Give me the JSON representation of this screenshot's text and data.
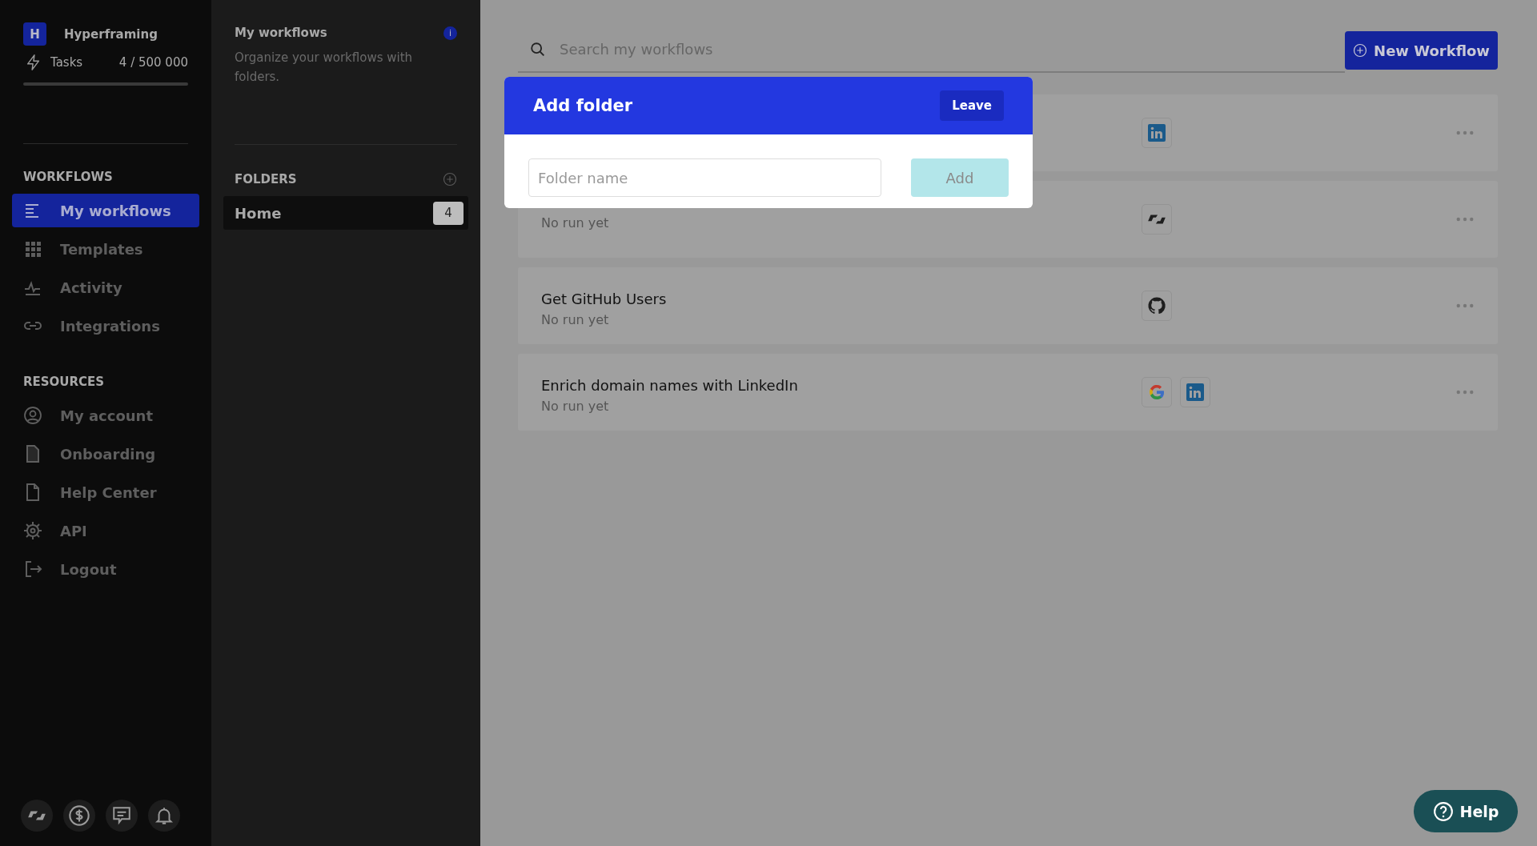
{
  "workspace": {
    "initial": "H",
    "name": "Hyperframing"
  },
  "tasks": {
    "label": "Tasks",
    "count": "4 / 500 000",
    "level": 0
  },
  "sidebar": {
    "sections": [
      {
        "title": "WORKFLOWS",
        "items": [
          {
            "label": "My workflows",
            "kind": "list",
            "selected": true
          },
          {
            "label": "Templates",
            "kind": "grid",
            "selected": false
          },
          {
            "label": "Activity",
            "kind": "activity",
            "selected": false
          },
          {
            "label": "Integrations",
            "kind": "link",
            "selected": false
          }
        ]
      },
      {
        "title": "RESOURCES",
        "items": [
          {
            "label": "My account",
            "kind": "account",
            "selected": false
          },
          {
            "label": "Onboarding",
            "kind": "doc-filled",
            "selected": false
          },
          {
            "label": "Help Center",
            "kind": "doc",
            "selected": false
          },
          {
            "label": "API",
            "kind": "gear",
            "selected": false
          },
          {
            "label": "Logout",
            "kind": "logout",
            "selected": false
          }
        ]
      }
    ],
    "footer_icons": [
      {
        "kind": "logo"
      },
      {
        "kind": "dollar"
      },
      {
        "kind": "chat"
      },
      {
        "kind": "bell"
      }
    ]
  },
  "folders_panel": {
    "title": "My workflows",
    "info": "i",
    "description": "Organize your workflows with folders.",
    "folders_title": "FOLDERS",
    "folders": [
      {
        "name": "Home",
        "count": "4",
        "selected": true
      }
    ]
  },
  "search": {
    "placeholder": "Search my workflows"
  },
  "new_workflow_button": "New Workflow",
  "workflows": [
    {
      "icons": [
        {
          "kind": "linkedin"
        }
      ]
    },
    {
      "subtitle": "No run yet",
      "icons": [
        {
          "kind": "logo"
        }
      ]
    },
    {
      "title": "Get GitHub Users",
      "subtitle": "No run yet",
      "icons": [
        {
          "kind": "github"
        }
      ]
    },
    {
      "title": "Enrich domain names with LinkedIn",
      "subtitle": "No run yet",
      "icons": [
        {
          "kind": "google"
        },
        {
          "kind": "linkedin"
        }
      ]
    }
  ],
  "dialog": {
    "title": "Add folder",
    "leave_button": "Leave",
    "field": {
      "placeholder": "Folder name"
    },
    "add_button": "Add",
    "add_disabled": true
  },
  "help_button": "Help"
}
